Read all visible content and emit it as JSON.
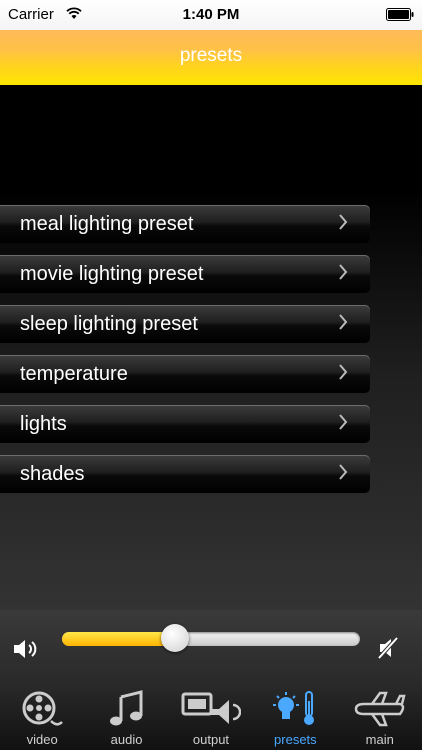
{
  "status_bar": {
    "carrier": "Carrier",
    "time": "1:40 PM"
  },
  "header": {
    "title": "presets"
  },
  "menu": {
    "items": [
      {
        "label": "meal lighting preset"
      },
      {
        "label": "movie lighting preset"
      },
      {
        "label": "sleep lighting preset"
      },
      {
        "label": "temperature"
      },
      {
        "label": "lights"
      },
      {
        "label": "shades"
      }
    ]
  },
  "volume": {
    "level": 0.38
  },
  "tabs": [
    {
      "label": "video",
      "icon": "film-reel-icon"
    },
    {
      "label": "audio",
      "icon": "music-note-icon"
    },
    {
      "label": "output",
      "icon": "projector-speaker-icon"
    },
    {
      "label": "presets",
      "icon": "lightbulb-thermometer-icon",
      "active": true
    },
    {
      "label": "main",
      "icon": "airplane-icon"
    }
  ],
  "colors": {
    "accent": "#4aa8ff",
    "header_top": "#ffba59",
    "header_bottom": "#ffe600"
  }
}
